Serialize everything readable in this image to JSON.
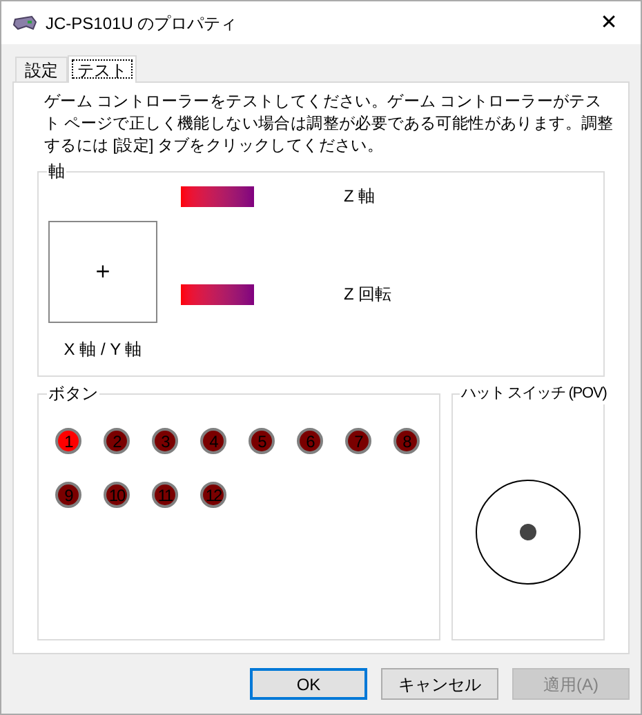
{
  "window": {
    "title": "JC-PS101U のプロパティ",
    "close": "✕"
  },
  "tabs": [
    {
      "label": "設定",
      "selected": false
    },
    {
      "label": "テスト",
      "selected": true
    }
  ],
  "intro": "ゲーム コントローラーをテストしてください。ゲーム コントローラーがテスト ページで正しく機能しない場合は調整が必要である可能性があります。調整するには [設定] タブをクリックしてください。",
  "axes": {
    "title": "軸",
    "xy_label": "X 軸 / Y 軸",
    "crosshair": "+",
    "bars": [
      {
        "label": "Z 軸",
        "level": 1
      },
      {
        "label": "Z 回転",
        "level": 1
      }
    ]
  },
  "buttons_group": {
    "title": "ボタン",
    "buttons": [
      {
        "label": "1",
        "pressed": true
      },
      {
        "label": "2",
        "pressed": false
      },
      {
        "label": "3",
        "pressed": false
      },
      {
        "label": "4",
        "pressed": false
      },
      {
        "label": "5",
        "pressed": false
      },
      {
        "label": "6",
        "pressed": false
      },
      {
        "label": "7",
        "pressed": false
      },
      {
        "label": "8",
        "pressed": false
      },
      {
        "label": "9",
        "pressed": false
      },
      {
        "label": "10",
        "pressed": false
      },
      {
        "label": "11",
        "pressed": false
      },
      {
        "label": "12",
        "pressed": false
      }
    ]
  },
  "hat_switch": {
    "title": "ハット スイッチ (POV)"
  },
  "dialog_buttons": [
    {
      "label": "OK",
      "default": true,
      "disabled": false
    },
    {
      "label": "キャンセル",
      "default": false,
      "disabled": false
    },
    {
      "label": "適用(A)",
      "default": false,
      "disabled": true
    }
  ]
}
